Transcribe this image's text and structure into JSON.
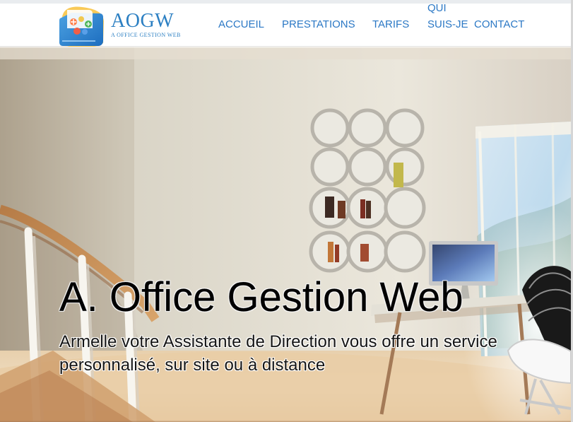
{
  "header": {
    "brand": {
      "name": "AOGW",
      "tagline": "A OFFICE GESTION WEB"
    },
    "nav": {
      "accueil": "ACCUEIL",
      "prestations": "PRESTATIONS",
      "tarifs": "TARIFS",
      "qui_suis_je": "QUI SUIS-JE",
      "contact": "CONTACT"
    }
  },
  "hero": {
    "title": "A. Office Gestion Web",
    "subtitle": "Armelle votre Assistante de Direction vous offre un service personnalisé, sur site ou à distance"
  },
  "colors": {
    "nav_link": "#2b78c5",
    "brand_blue": "#2d80c3",
    "hero_text": "#000000"
  },
  "icons": {
    "logo": "office-folder-logo-icon"
  }
}
